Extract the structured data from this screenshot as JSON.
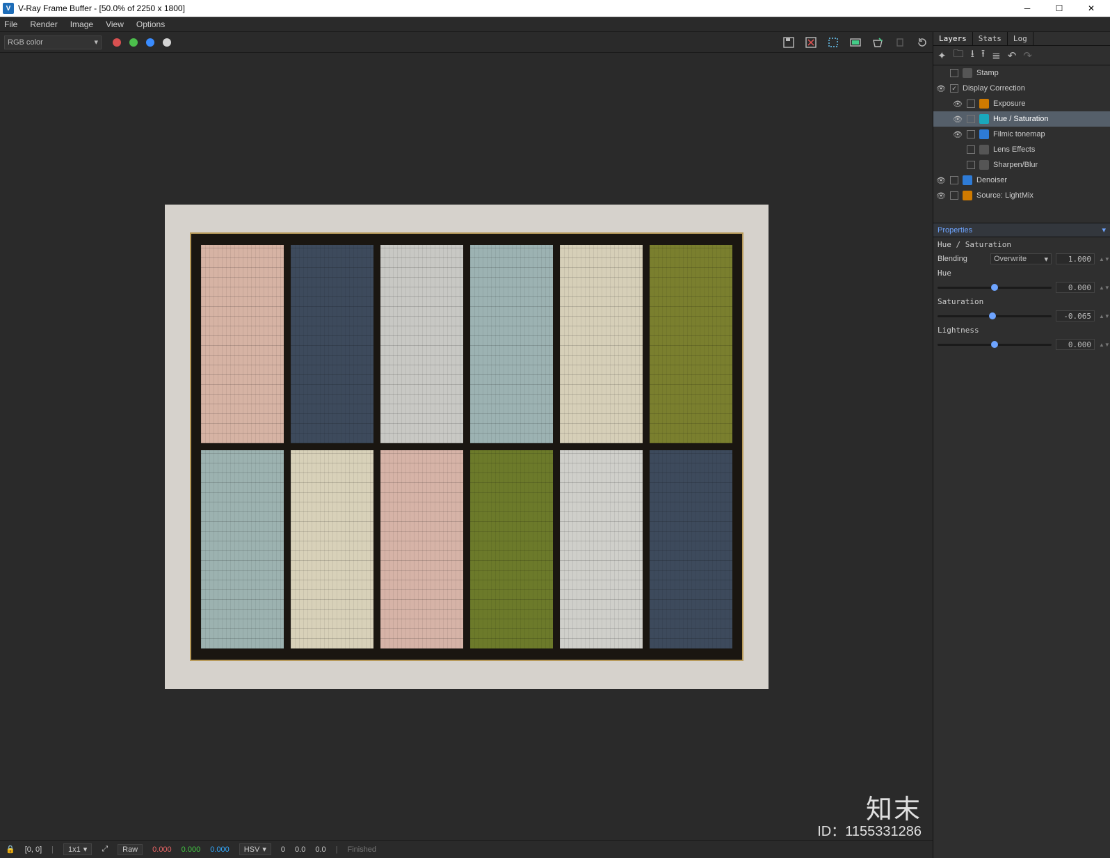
{
  "window": {
    "title": "V-Ray Frame Buffer - [50.0% of 2250 x 1800]",
    "app_badge": "V"
  },
  "menu": {
    "file": "File",
    "render": "Render",
    "image": "Image",
    "view": "View",
    "options": "Options"
  },
  "toolbar": {
    "channel": "RGB color",
    "rgb": {
      "r": "#e66",
      "g": "#4c4",
      "b": "#3af",
      "a": "#ddd"
    }
  },
  "swatches_top": [
    "#d6b3a4",
    "#3d4a5c",
    "#c8c8c4",
    "#9cb2b2",
    "#d6cfb8",
    "#7a7f2e"
  ],
  "swatches_bottom": [
    "#9cb2b0",
    "#d8d1b9",
    "#d6b3a7",
    "#6c7a2a",
    "#cfcfca",
    "#3d4a5c"
  ],
  "statusbar": {
    "lock": "🔒",
    "coords": "[0, 0]",
    "zoom": "1x1",
    "raw_label": "Raw",
    "raw_r": "0.000",
    "raw_g": "0.000",
    "raw_b": "0.000",
    "mode": "HSV",
    "h": "0",
    "s": "0.0",
    "v": "0.0",
    "state": "Finished"
  },
  "right": {
    "tabs": {
      "layers": "Layers",
      "stats": "Stats",
      "log": "Log"
    },
    "layers": [
      {
        "eye": false,
        "check": false,
        "indent": 0,
        "icon": "gray",
        "label": "Stamp"
      },
      {
        "eye": true,
        "check": true,
        "indent": 0,
        "icon": "",
        "label": "Display Correction"
      },
      {
        "eye": true,
        "check": false,
        "indent": 1,
        "icon": "orange",
        "label": "Exposure"
      },
      {
        "eye": true,
        "check": false,
        "indent": 1,
        "icon": "teal",
        "label": "Hue / Saturation",
        "selected": true
      },
      {
        "eye": true,
        "check": false,
        "indent": 1,
        "icon": "blue",
        "label": "Filmic tonemap"
      },
      {
        "eye": false,
        "check": false,
        "indent": 1,
        "icon": "gray",
        "label": "Lens Effects"
      },
      {
        "eye": false,
        "check": false,
        "indent": 1,
        "icon": "gray",
        "label": "Sharpen/Blur"
      },
      {
        "eye": true,
        "check": false,
        "indent": 0,
        "icon": "blue",
        "label": "Denoiser"
      },
      {
        "eye": true,
        "check": false,
        "indent": 0,
        "icon": "orange",
        "label": "Source: LightMix"
      }
    ],
    "properties": {
      "title": "Properties",
      "sub": "Hue / Saturation",
      "blending_label": "Blending",
      "blending_value": "Overwrite",
      "blending_amount": "1.000",
      "hue_label": "Hue",
      "hue_value": "0.000",
      "sat_label": "Saturation",
      "sat_value": "-0.065",
      "light_label": "Lightness",
      "light_value": "0.000"
    }
  },
  "watermark": {
    "brand": "知末",
    "id": "ID：1155331286"
  }
}
